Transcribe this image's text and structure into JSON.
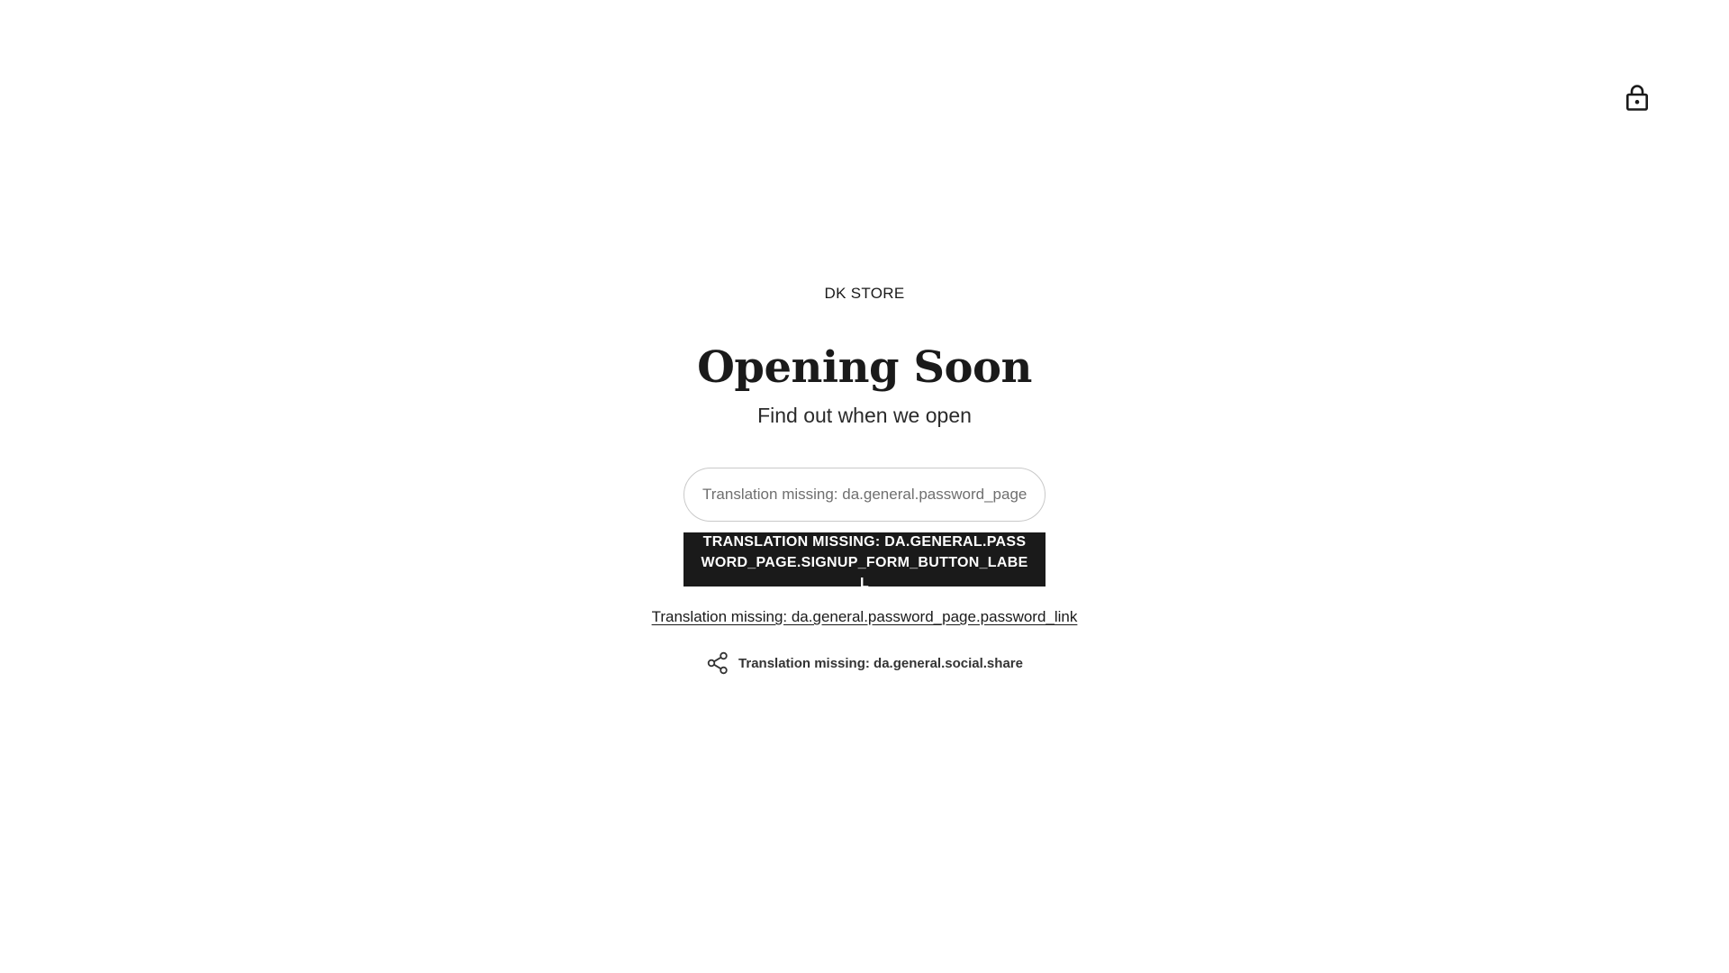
{
  "header": {
    "lock_icon": "lock-icon"
  },
  "main": {
    "store_name": "DK STORE",
    "headline": "Opening Soon",
    "subtext": "Find out when we open"
  },
  "signup_form": {
    "email_placeholder": "Translation missing: da.general.password_page.signup_form_email_label",
    "button_label": "Translation missing: da.general.password_page.signup_form_button_label"
  },
  "password_link": {
    "label": "Translation missing: da.general.password_page.password_link"
  },
  "share": {
    "icon": "share-icon",
    "label": "Translation missing: da.general.social.share"
  },
  "colors": {
    "background": "#ffffff",
    "text": "#1a1a1a",
    "button_bg": "#1a1a1a",
    "button_text": "#ffffff",
    "input_border": "#c9c9c9"
  }
}
